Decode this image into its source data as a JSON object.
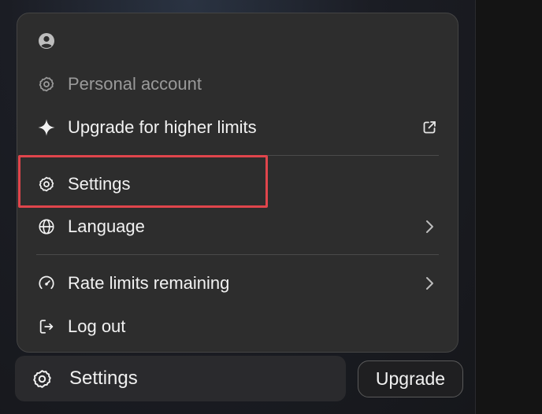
{
  "menu": {
    "account_label": "Personal account",
    "upgrade_label": "Upgrade for higher limits",
    "settings_label": "Settings",
    "language_label": "Language",
    "rate_limits_label": "Rate limits remaining",
    "logout_label": "Log out"
  },
  "footer": {
    "settings_label": "Settings",
    "upgrade_label": "Upgrade"
  },
  "icons": {
    "avatar": "user-avatar-icon",
    "account": "gear-icon",
    "upgrade": "sparkle-icon",
    "external": "external-link-icon",
    "settings": "gear-icon",
    "language": "globe-icon",
    "rate_limits": "gauge-icon",
    "logout": "logout-icon",
    "chevron": "chevron-right-icon"
  },
  "colors": {
    "highlight": "#e0454c",
    "menu_bg": "#2d2d2d",
    "text": "#f2f2f2",
    "muted_text": "#9a9a9a"
  }
}
